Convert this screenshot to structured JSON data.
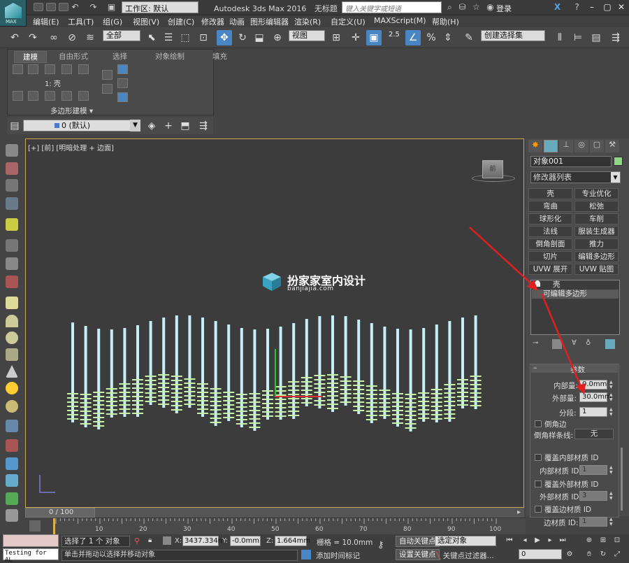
{
  "app": {
    "title": "Autodesk 3ds Max 2016",
    "doc": "无标题",
    "workspace": "工作区: 默认",
    "search_placeholder": "键入关键字或短语",
    "login": "登录",
    "logo_text": "MAX"
  },
  "menu": [
    "编辑(E)",
    "工具(T)",
    "组(G)",
    "视图(V)",
    "创建(C)",
    "修改器",
    "动画",
    "图形编辑器",
    "渲染(R)",
    "自定义(U)",
    "MAXScript(M)",
    "帮助(H)"
  ],
  "toolbar": {
    "filter": "全部",
    "coord": "视图",
    "snap_value": "2.5",
    "selection_set": "创建选择集"
  },
  "ribbon": {
    "tabs": [
      "建模",
      "自由形式",
      "选择",
      "对象绘制",
      "填充"
    ],
    "level_label": "1: 壳",
    "panel_label": "多边形建模"
  },
  "layer": {
    "current": "0 (默认)"
  },
  "viewport": {
    "label": "[+] [前] [明暗处理 + 边面]",
    "cube_label": "前",
    "watermark_title": "扮家家室内设计",
    "watermark_sub": "banjiajia.com"
  },
  "command_panel": {
    "object_name": "对象001",
    "object_color": "#8ed883",
    "modifier_list": "修改器列表",
    "modifier_buttons": [
      "壳",
      "专业优化",
      "弯曲",
      "松弛",
      "球形化",
      "车削",
      "法线",
      "服装生成器",
      "倒角剖面",
      "推力",
      "切片",
      "编辑多边形",
      "UVW 展开",
      "UVW 贴图"
    ],
    "stack": [
      "壳",
      "可编辑多边形"
    ],
    "params": {
      "title": "参数",
      "inner_label": "内部量:",
      "inner_value": "0.0mm",
      "outer_label": "外部量:",
      "outer_value": "30.0mm",
      "segments_label": "分段:",
      "segments_value": "1",
      "bevel_edge": "倒角边",
      "bevel_spline_label": "倒角样条线:",
      "bevel_spline_value": "无",
      "override_inner": "覆盖内部材质 ID",
      "inner_mat_label": "内部材质 ID:",
      "inner_mat_value": "1",
      "override_outer": "覆盖外部材质 ID",
      "outer_mat_label": "外部材质 ID:",
      "outer_mat_value": "3",
      "override_edge": "覆盖边材质 ID",
      "edge_mat_label": "边材质 ID:",
      "edge_mat_value": "1"
    }
  },
  "timeline": {
    "frame": "0 / 100",
    "ticks": [
      "10",
      "20",
      "30",
      "40",
      "50",
      "60",
      "70",
      "80",
      "90",
      "100"
    ]
  },
  "status": {
    "maxscript": "Testing for AL",
    "selected": "选择了 1 个 对象",
    "prompt": "单击并拖动以选择并移动对象",
    "x_label": "X:",
    "x": "3437.334m",
    "y_label": "Y:",
    "y": "-0.0mm",
    "z_label": "Z:",
    "z": "1.664mm",
    "grid": "栅格 = 10.0mm",
    "add_time_tag": "添加时间标记",
    "auto_key": "自动关键点",
    "selected_obj": "选定对象",
    "set_key": "设置关键点",
    "key_filter": "关键点过滤器...",
    "frame_value": "0"
  }
}
